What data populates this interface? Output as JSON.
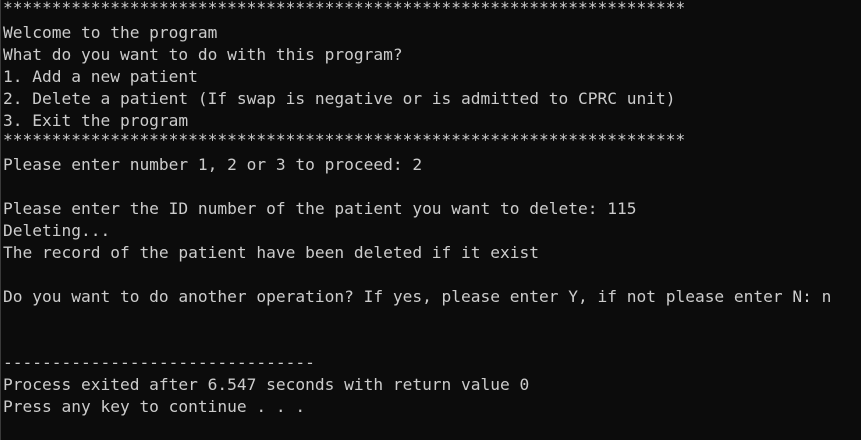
{
  "console": {
    "separator_top": "**********************************************************************",
    "welcome": "Welcome to the program",
    "question": "What do you want to do with this program?",
    "options": [
      "1. Add a new patient",
      "2. Delete a patient (If swap is negative or is admitted to CPRC unit)",
      "3. Exit the program"
    ],
    "separator_bottom": "**********************************************************************",
    "prompt_choice": "Please enter number 1, 2 or 3 to proceed: 2",
    "prompt_id": "Please enter the ID number of the patient you want to delete: 115",
    "deleting": "Deleting...",
    "result": "The record of the patient have been deleted if it exist",
    "prompt_again": "Do you want to do another operation? If yes, please enter Y, if not please enter N: n",
    "divider": "--------------------------------",
    "process_exit": "Process exited after 6.547 seconds with return value 0",
    "press_key": "Press any key to continue . . ."
  }
}
